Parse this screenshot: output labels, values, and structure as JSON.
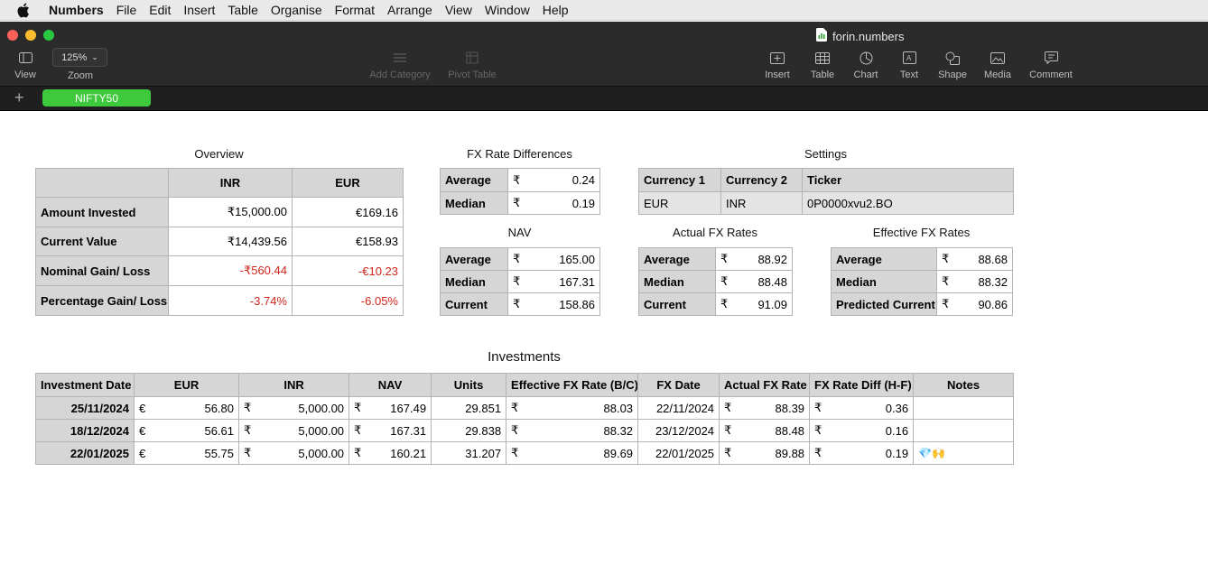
{
  "menubar": {
    "app": "Numbers",
    "items": [
      "File",
      "Edit",
      "Insert",
      "Table",
      "Organise",
      "Format",
      "Arrange",
      "View",
      "Window",
      "Help"
    ]
  },
  "window": {
    "doc_title": "forin.numbers",
    "zoom": "125%",
    "toolbar_left": {
      "view": "View",
      "zoom": "Zoom"
    },
    "toolbar_mid": {
      "add_category": "Add Category",
      "pivot_table": "Pivot Table"
    },
    "toolbar_right": {
      "insert": "Insert",
      "table": "Table",
      "chart": "Chart",
      "text": "Text",
      "shape": "Shape",
      "media": "Media",
      "comment": "Comment"
    }
  },
  "sheet": {
    "plus": "+",
    "tab": "NIFTY50"
  },
  "overview": {
    "title": "Overview",
    "headers": [
      "INR",
      "EUR"
    ],
    "rows": [
      {
        "label": "Amount Invested",
        "inr": "₹15,000.00",
        "eur": "€169.16"
      },
      {
        "label": "Current Value",
        "inr": "₹14,439.56",
        "eur": "€158.93"
      },
      {
        "label": "Nominal Gain/ Loss",
        "inr": "-₹560.44",
        "eur": "-€10.23"
      },
      {
        "label": "Percentage Gain/ Loss",
        "inr": "-3.74%",
        "eur": "-6.05%"
      }
    ]
  },
  "fx_diff": {
    "title": "FX Rate Differences",
    "sym": "₹",
    "rows": [
      {
        "label": "Average",
        "value": "0.24"
      },
      {
        "label": "Median",
        "value": "0.19"
      }
    ]
  },
  "settings": {
    "title": "Settings",
    "headers": [
      "Currency 1",
      "Currency 2",
      "Ticker"
    ],
    "values": [
      "EUR",
      "INR",
      "0P0000xvu2.BO"
    ]
  },
  "nav": {
    "title": "NAV",
    "sym": "₹",
    "rows": [
      {
        "label": "Average",
        "value": "165.00"
      },
      {
        "label": "Median",
        "value": "167.31"
      },
      {
        "label": "Current",
        "value": "158.86"
      }
    ]
  },
  "actual_fx": {
    "title": "Actual FX Rates",
    "sym": "₹",
    "rows": [
      {
        "label": "Average",
        "value": "88.92"
      },
      {
        "label": "Median",
        "value": "88.48"
      },
      {
        "label": "Current",
        "value": "91.09"
      }
    ]
  },
  "effective_fx": {
    "title": "Effective FX Rates",
    "sym": "₹",
    "rows": [
      {
        "label": "Average",
        "value": "88.68"
      },
      {
        "label": "Median",
        "value": "88.32"
      },
      {
        "label": "Predicted Current",
        "value": "90.86"
      }
    ]
  },
  "investments": {
    "title": "Investments",
    "headers": [
      "Investment Date",
      "EUR",
      "INR",
      "NAV",
      "Units",
      "Effective FX Rate (B/C)",
      "FX Date",
      "Actual FX Rate",
      "FX Rate Diff (H-F)",
      "Notes"
    ],
    "eur_sym": "€",
    "inr_sym": "₹",
    "rows": [
      {
        "date": "25/11/2024",
        "eur": "56.80",
        "inr": "5,000.00",
        "nav": "167.49",
        "units": "29.851",
        "eff": "88.03",
        "fxdate": "22/11/2024",
        "actual": "88.39",
        "diff": "0.36",
        "notes": ""
      },
      {
        "date": "18/12/2024",
        "eur": "56.61",
        "inr": "5,000.00",
        "nav": "167.31",
        "units": "29.838",
        "eff": "88.32",
        "fxdate": "23/12/2024",
        "actual": "88.48",
        "diff": "0.16",
        "notes": ""
      },
      {
        "date": "22/01/2025",
        "eur": "55.75",
        "inr": "5,000.00",
        "nav": "160.21",
        "units": "31.207",
        "eff": "89.69",
        "fxdate": "22/01/2025",
        "actual": "89.88",
        "diff": "0.19",
        "notes": "💎🙌"
      }
    ]
  }
}
